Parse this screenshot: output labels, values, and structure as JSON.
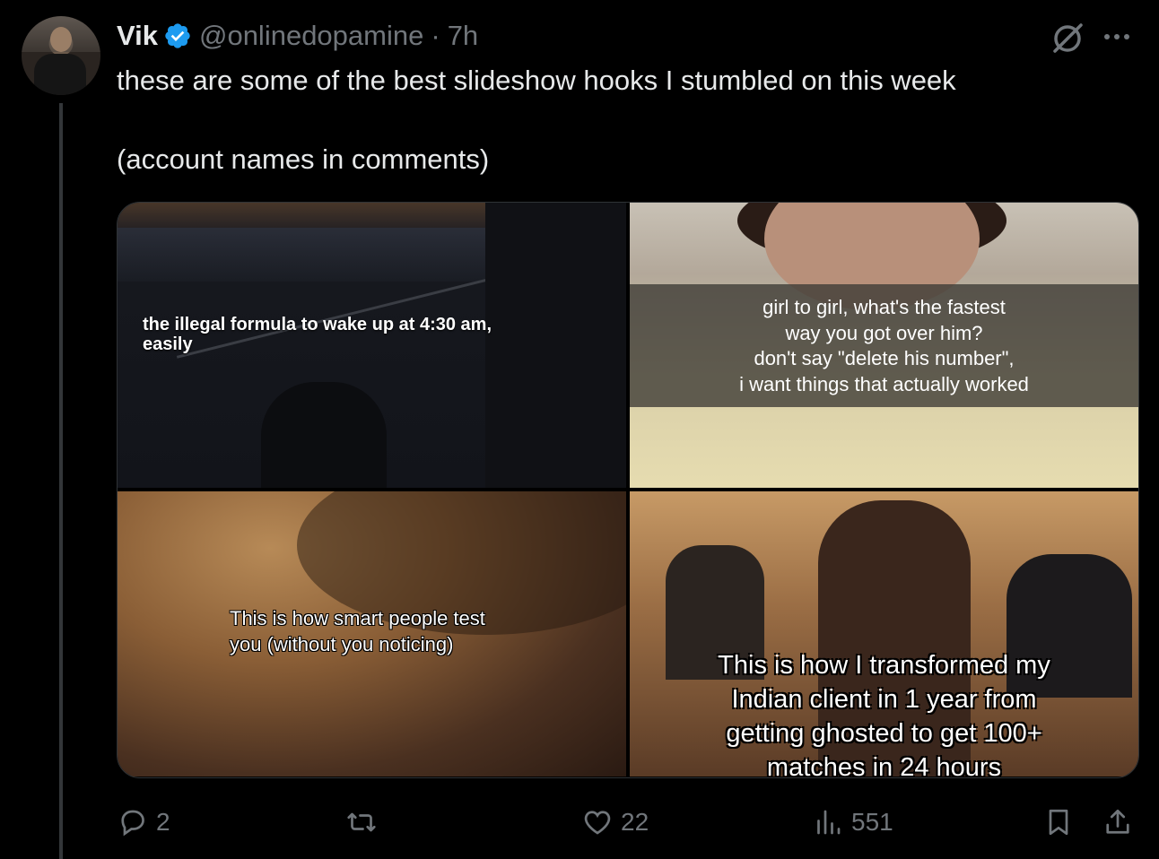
{
  "author": {
    "name": "Vik",
    "handle": "@onlinedopamine",
    "separator": "·",
    "time": "7h",
    "verified_color": "#1d9bf0"
  },
  "tweet": {
    "line1": "these are some of the best slideshow hooks I stumbled on this week",
    "line2": "(account names in comments)"
  },
  "media": [
    {
      "caption": "the illegal formula to wake up at 4:30 am, easily"
    },
    {
      "caption_lines": [
        "girl to girl, what's the fastest",
        "way you got over him?",
        "don't say \"delete his number\",",
        "i want things that actually worked"
      ]
    },
    {
      "caption_lines": [
        "This is how smart people test",
        "you (without you noticing)"
      ]
    },
    {
      "caption_lines": [
        "This is how I transformed my",
        "Indian client in 1 year from",
        "getting ghosted to get 100+",
        "matches in 24 hours"
      ]
    }
  ],
  "actions": {
    "replies": "2",
    "retweets": "",
    "likes": "22",
    "views": "551"
  },
  "icons": {
    "more": "more-horizontal-icon",
    "grok": "grok-icon",
    "reply": "reply-icon",
    "retweet": "retweet-icon",
    "like": "heart-icon",
    "views": "views-icon",
    "bookmark": "bookmark-icon",
    "share": "share-icon"
  }
}
